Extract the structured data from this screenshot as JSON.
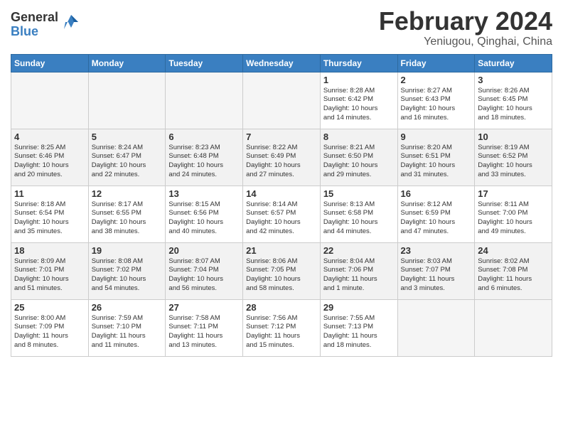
{
  "header": {
    "logo_general": "General",
    "logo_blue": "Blue",
    "month_year": "February 2024",
    "location": "Yeniugou, Qinghai, China"
  },
  "days_of_week": [
    "Sunday",
    "Monday",
    "Tuesday",
    "Wednesday",
    "Thursday",
    "Friday",
    "Saturday"
  ],
  "weeks": [
    [
      {
        "day": "",
        "info": ""
      },
      {
        "day": "",
        "info": ""
      },
      {
        "day": "",
        "info": ""
      },
      {
        "day": "",
        "info": ""
      },
      {
        "day": "1",
        "info": "Sunrise: 8:28 AM\nSunset: 6:42 PM\nDaylight: 10 hours\nand 14 minutes."
      },
      {
        "day": "2",
        "info": "Sunrise: 8:27 AM\nSunset: 6:43 PM\nDaylight: 10 hours\nand 16 minutes."
      },
      {
        "day": "3",
        "info": "Sunrise: 8:26 AM\nSunset: 6:45 PM\nDaylight: 10 hours\nand 18 minutes."
      }
    ],
    [
      {
        "day": "4",
        "info": "Sunrise: 8:25 AM\nSunset: 6:46 PM\nDaylight: 10 hours\nand 20 minutes."
      },
      {
        "day": "5",
        "info": "Sunrise: 8:24 AM\nSunset: 6:47 PM\nDaylight: 10 hours\nand 22 minutes."
      },
      {
        "day": "6",
        "info": "Sunrise: 8:23 AM\nSunset: 6:48 PM\nDaylight: 10 hours\nand 24 minutes."
      },
      {
        "day": "7",
        "info": "Sunrise: 8:22 AM\nSunset: 6:49 PM\nDaylight: 10 hours\nand 27 minutes."
      },
      {
        "day": "8",
        "info": "Sunrise: 8:21 AM\nSunset: 6:50 PM\nDaylight: 10 hours\nand 29 minutes."
      },
      {
        "day": "9",
        "info": "Sunrise: 8:20 AM\nSunset: 6:51 PM\nDaylight: 10 hours\nand 31 minutes."
      },
      {
        "day": "10",
        "info": "Sunrise: 8:19 AM\nSunset: 6:52 PM\nDaylight: 10 hours\nand 33 minutes."
      }
    ],
    [
      {
        "day": "11",
        "info": "Sunrise: 8:18 AM\nSunset: 6:54 PM\nDaylight: 10 hours\nand 35 minutes."
      },
      {
        "day": "12",
        "info": "Sunrise: 8:17 AM\nSunset: 6:55 PM\nDaylight: 10 hours\nand 38 minutes."
      },
      {
        "day": "13",
        "info": "Sunrise: 8:15 AM\nSunset: 6:56 PM\nDaylight: 10 hours\nand 40 minutes."
      },
      {
        "day": "14",
        "info": "Sunrise: 8:14 AM\nSunset: 6:57 PM\nDaylight: 10 hours\nand 42 minutes."
      },
      {
        "day": "15",
        "info": "Sunrise: 8:13 AM\nSunset: 6:58 PM\nDaylight: 10 hours\nand 44 minutes."
      },
      {
        "day": "16",
        "info": "Sunrise: 8:12 AM\nSunset: 6:59 PM\nDaylight: 10 hours\nand 47 minutes."
      },
      {
        "day": "17",
        "info": "Sunrise: 8:11 AM\nSunset: 7:00 PM\nDaylight: 10 hours\nand 49 minutes."
      }
    ],
    [
      {
        "day": "18",
        "info": "Sunrise: 8:09 AM\nSunset: 7:01 PM\nDaylight: 10 hours\nand 51 minutes."
      },
      {
        "day": "19",
        "info": "Sunrise: 8:08 AM\nSunset: 7:02 PM\nDaylight: 10 hours\nand 54 minutes."
      },
      {
        "day": "20",
        "info": "Sunrise: 8:07 AM\nSunset: 7:04 PM\nDaylight: 10 hours\nand 56 minutes."
      },
      {
        "day": "21",
        "info": "Sunrise: 8:06 AM\nSunset: 7:05 PM\nDaylight: 10 hours\nand 58 minutes."
      },
      {
        "day": "22",
        "info": "Sunrise: 8:04 AM\nSunset: 7:06 PM\nDaylight: 11 hours\nand 1 minute."
      },
      {
        "day": "23",
        "info": "Sunrise: 8:03 AM\nSunset: 7:07 PM\nDaylight: 11 hours\nand 3 minutes."
      },
      {
        "day": "24",
        "info": "Sunrise: 8:02 AM\nSunset: 7:08 PM\nDaylight: 11 hours\nand 6 minutes."
      }
    ],
    [
      {
        "day": "25",
        "info": "Sunrise: 8:00 AM\nSunset: 7:09 PM\nDaylight: 11 hours\nand 8 minutes."
      },
      {
        "day": "26",
        "info": "Sunrise: 7:59 AM\nSunset: 7:10 PM\nDaylight: 11 hours\nand 11 minutes."
      },
      {
        "day": "27",
        "info": "Sunrise: 7:58 AM\nSunset: 7:11 PM\nDaylight: 11 hours\nand 13 minutes."
      },
      {
        "day": "28",
        "info": "Sunrise: 7:56 AM\nSunset: 7:12 PM\nDaylight: 11 hours\nand 15 minutes."
      },
      {
        "day": "29",
        "info": "Sunrise: 7:55 AM\nSunset: 7:13 PM\nDaylight: 11 hours\nand 18 minutes."
      },
      {
        "day": "",
        "info": ""
      },
      {
        "day": "",
        "info": ""
      }
    ]
  ]
}
